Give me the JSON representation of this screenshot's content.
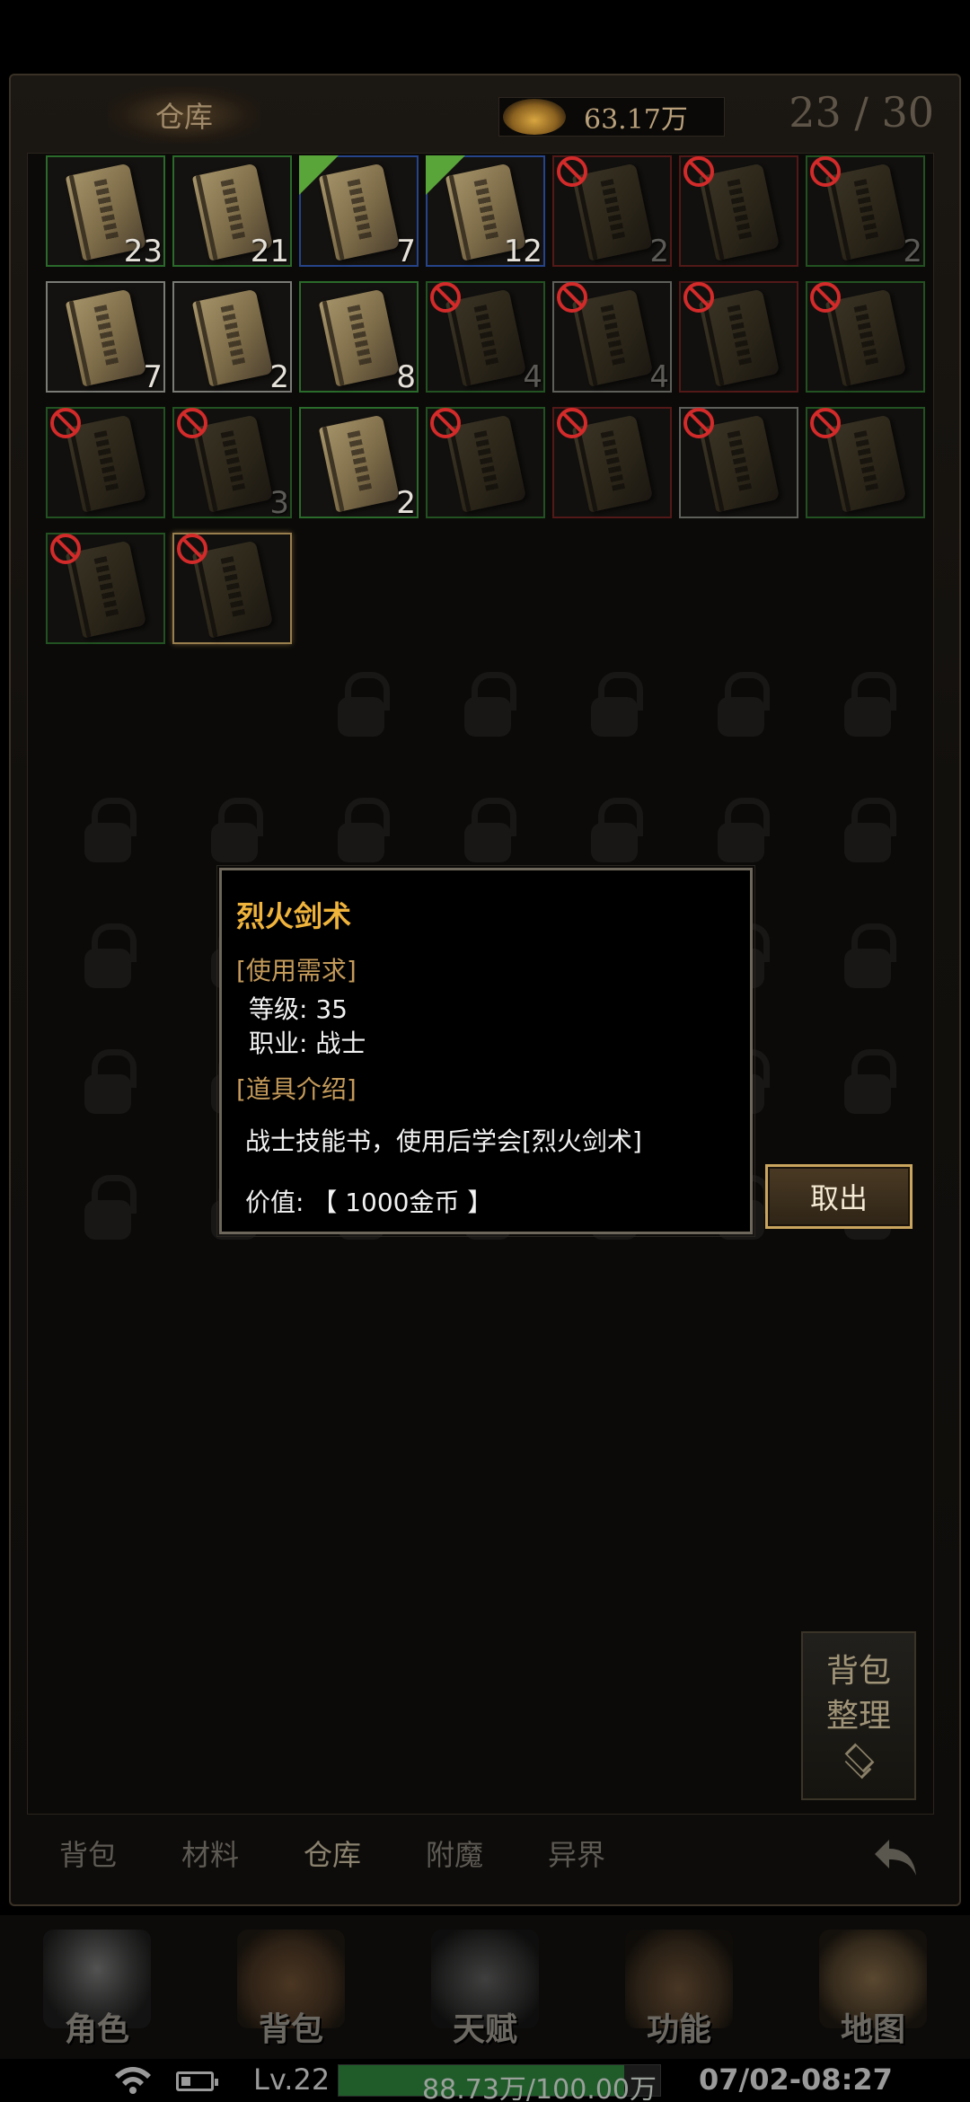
{
  "header": {
    "tab_label": "仓库",
    "gold_amount": "63.17万",
    "capacity": "23 / 30"
  },
  "items": [
    {
      "qty": "23",
      "rarity": "green",
      "usable": true,
      "new": false
    },
    {
      "qty": "21",
      "rarity": "green",
      "usable": true,
      "new": false
    },
    {
      "qty": "7",
      "rarity": "blue",
      "usable": true,
      "new": true
    },
    {
      "qty": "12",
      "rarity": "blue",
      "usable": true,
      "new": true
    },
    {
      "qty": "2",
      "rarity": "red",
      "usable": false,
      "new": false
    },
    {
      "qty": "",
      "rarity": "red",
      "usable": false,
      "new": false
    },
    {
      "qty": "2",
      "rarity": "green",
      "usable": false,
      "new": false
    },
    {
      "qty": "7",
      "rarity": "white",
      "usable": true,
      "new": false
    },
    {
      "qty": "2",
      "rarity": "white",
      "usable": true,
      "new": false
    },
    {
      "qty": "8",
      "rarity": "green",
      "usable": true,
      "new": false
    },
    {
      "qty": "4",
      "rarity": "green",
      "usable": false,
      "new": false
    },
    {
      "qty": "4",
      "rarity": "white",
      "usable": false,
      "new": false
    },
    {
      "qty": "",
      "rarity": "red",
      "usable": false,
      "new": false
    },
    {
      "qty": "",
      "rarity": "green",
      "usable": false,
      "new": false
    },
    {
      "qty": "",
      "rarity": "green",
      "usable": false,
      "new": false
    },
    {
      "qty": "3",
      "rarity": "green",
      "usable": false,
      "new": false
    },
    {
      "qty": "2",
      "rarity": "green",
      "usable": true,
      "new": false
    },
    {
      "qty": "",
      "rarity": "green",
      "usable": false,
      "new": false
    },
    {
      "qty": "",
      "rarity": "red",
      "usable": false,
      "new": false
    },
    {
      "qty": "",
      "rarity": "white",
      "usable": false,
      "new": false
    },
    {
      "qty": "",
      "rarity": "green",
      "usable": false,
      "new": false
    },
    {
      "qty": "",
      "rarity": "green",
      "usable": false,
      "new": false
    },
    {
      "qty": "",
      "rarity": "sel",
      "usable": false,
      "new": false
    }
  ],
  "tooltip": {
    "title": "烈火剑术",
    "req_header": "[使用需求]",
    "level": "等级: 35",
    "job": "职业: 战士",
    "intro_header": "[道具介绍]",
    "description": "战士技能书，使用后学会[烈火剑术]",
    "value": "价值: 【 1000金币 】"
  },
  "take_button": "取出",
  "sort_button": {
    "line1": "背包",
    "line2": "整理"
  },
  "sub_tabs": [
    "背包",
    "材料",
    "仓库",
    "附魔",
    "异界"
  ],
  "active_sub_tab": "仓库",
  "bottom_nav": [
    "角色",
    "背包",
    "天赋",
    "功能",
    "地图"
  ],
  "status": {
    "level": "Lv.22",
    "exp_text": "88.73万/100.00万",
    "exp_fraction": 0.8873,
    "clock": "07/02-08:27"
  },
  "colors": {
    "accent_gold": "#c9a55e",
    "title_orange": "#f0b43c",
    "exp_green": "#1f5c2a"
  }
}
